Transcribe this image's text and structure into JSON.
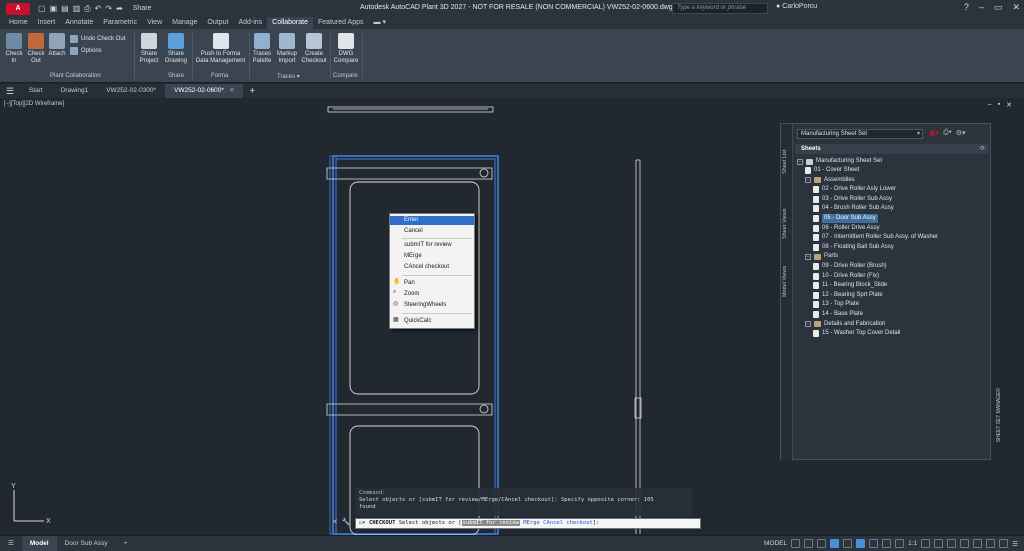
{
  "app": {
    "logo_text": "A",
    "share_label": "Share",
    "title": "Autodesk AutoCAD Plant 3D 2027 - NOT FOR RESALE (NON COMMERCIAL)   VW252-02-0600.dwg",
    "search_placeholder": "Type a keyword or phrase",
    "user": "CarloPorcu"
  },
  "ribbon_tabs": [
    "Home",
    "Insert",
    "Annotate",
    "Parametric",
    "View",
    "Manage",
    "Output",
    "Add-ins",
    "Collaborate",
    "Featured Apps"
  ],
  "ribbon": {
    "buttons": [
      {
        "label1": "Check",
        "label2": "In"
      },
      {
        "label1": "Check",
        "label2": "Out"
      },
      {
        "label1": "Attach",
        "label2": ""
      },
      {
        "label1": "Share",
        "label2": "Project"
      },
      {
        "label1": "Share",
        "label2": "Drawing"
      },
      {
        "label1": "Push to Forma",
        "label2": "Data Management"
      },
      {
        "label1": "Traces",
        "label2": "Palette"
      },
      {
        "label1": "Markup",
        "label2": "Import"
      },
      {
        "label1": "Create",
        "label2": "Checkout"
      },
      {
        "label1": "DWG",
        "label2": "Compare"
      }
    ],
    "small_buttons": [
      "Undo Check Out",
      "Options"
    ],
    "groups": [
      "Plant Collaboration",
      "Share",
      "Forma",
      "Traces",
      "Compare"
    ]
  },
  "file_tabs": [
    "Start",
    "Drawing1",
    "VW252-02-0300*",
    "VW252-02-0600*"
  ],
  "viewport_label": "[−][Top][2D Wireframe]",
  "context_menu": {
    "items": [
      "Enter",
      "Cancel",
      "submIT for review",
      "MErge",
      "CAncel checkout",
      "Pan",
      "Zoom",
      "SteeringWheels",
      "QuickCalc"
    ]
  },
  "sheet_set": {
    "combo": "Manufacturing Sheet Set",
    "header": "Sheets",
    "side_tabs": [
      "Sheet List",
      "Sheet Views",
      "Model Views"
    ],
    "panel_title": "SHEET SET MANAGER",
    "root": "Manufacturing Sheet Set",
    "nodes": [
      {
        "level": 1,
        "type": "sheet",
        "label": "01 - Cover Sheet"
      },
      {
        "level": 1,
        "type": "folder",
        "label": "Assemblies"
      },
      {
        "level": 2,
        "type": "sheet",
        "label": "02 - Drive Roller Asly Lower"
      },
      {
        "level": 2,
        "type": "sheet",
        "label": "03 - Drive Roller Sub Assy"
      },
      {
        "level": 2,
        "type": "sheet",
        "label": "04 - Brush Roller Sub Assy"
      },
      {
        "level": 2,
        "type": "sheet",
        "label": "05 - Door Sub Assy",
        "selected": true
      },
      {
        "level": 2,
        "type": "sheet",
        "label": "06 - Roller Drive Assy"
      },
      {
        "level": 2,
        "type": "sheet",
        "label": "07 - Intermittent Roller Sub Assy. of Washer"
      },
      {
        "level": 2,
        "type": "sheet",
        "label": "08 - Floating Ball Sub Assy"
      },
      {
        "level": 1,
        "type": "folder",
        "label": "Parts"
      },
      {
        "level": 2,
        "type": "sheet",
        "label": "09 - Drive Roller (Brush)"
      },
      {
        "level": 2,
        "type": "sheet",
        "label": "10 - Drive Roller (Fix)"
      },
      {
        "level": 2,
        "type": "sheet",
        "label": "11 - Bearing Block_Slide"
      },
      {
        "level": 2,
        "type": "sheet",
        "label": "12 - Bearing Sprt Plate"
      },
      {
        "level": 2,
        "type": "sheet",
        "label": "13 - Top Plate"
      },
      {
        "level": 2,
        "type": "sheet",
        "label": "14 - Base Plate"
      },
      {
        "level": 1,
        "type": "folder",
        "label": "Details and Fabrication"
      },
      {
        "level": 2,
        "type": "sheet",
        "label": "15 - Washer Top Cover Detail"
      }
    ]
  },
  "command": {
    "history_header": "Command:",
    "history_line1": "Select objects or [submIT for review/MErge/CAncel checkout]: Specify opposite corner: 105",
    "history_line2": "found",
    "prompt_cmd": "CHECKOUT",
    "prompt_text": "Select objects or [",
    "opt1": "submIT for review",
    "opt2": "MErge",
    "opt3": "CAncel checkout",
    "prompt_end": "]:"
  },
  "status": {
    "tabs": [
      "Model",
      "Door Sub Assy"
    ],
    "mode": "MODEL",
    "scale": "1:1"
  },
  "colors": {
    "selection_blue": "#3f7fe0",
    "brand_red": "#c8102e"
  }
}
